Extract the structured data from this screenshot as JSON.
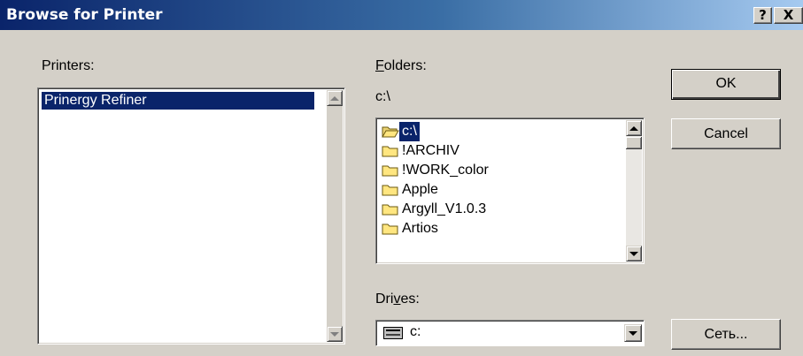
{
  "window": {
    "title": "Browse for Printer",
    "help_label": "?",
    "close_label": "X"
  },
  "printers": {
    "label": "Printers:",
    "items": [
      "Prinergy Refiner"
    ]
  },
  "folders": {
    "label_u": "F",
    "label_rest": "olders:",
    "current_path": "c:\\",
    "items": [
      "c:\\",
      "!ARCHIV",
      "!WORK_color",
      "Apple",
      "Argyll_V1.0.3",
      "Artios"
    ],
    "selected_index": 0
  },
  "drives": {
    "label_pre": "Dri",
    "label_u": "v",
    "label_rest": "es:",
    "selected": "c:",
    "icon": "drive-icon"
  },
  "buttons": {
    "ok": "OK",
    "cancel": "Cancel",
    "network": "Сеть..."
  },
  "colors": {
    "selection": "#0a246a",
    "face": "#d4d0c8",
    "folder": "#ffe680"
  }
}
